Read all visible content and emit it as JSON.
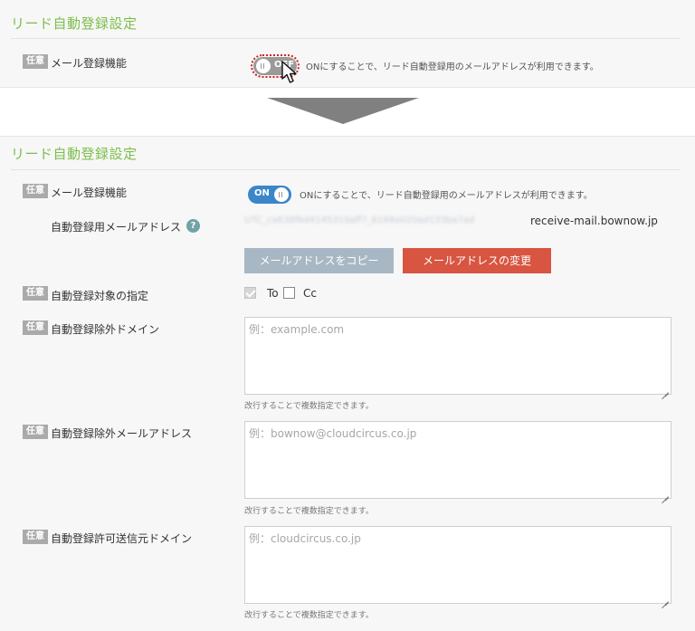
{
  "top": {
    "title": "リード自動登録設定",
    "optional_badge": "任意",
    "mail_registration_label": "メール登録機能",
    "toggle_state": "OFF",
    "toggle_text": "ON",
    "hint": "ONにすることで、リード自動登録用のメールアドレスが利用できます。"
  },
  "bottom": {
    "title": "リード自動登録設定",
    "mail_registration": {
      "badge": "任意",
      "label": "メール登録機能",
      "toggle_text": "ON",
      "hint": "ONにすることで、リード自動登録用のメールアドレスが利用できます。"
    },
    "address": {
      "label": "自動登録用メールアドレス",
      "help_icon": "?",
      "masked_local": "UTC_ca638f6d4145310aff7_6168a020ad133ba7ad",
      "domain": "receive-mail.bownow.jp"
    },
    "buttons": {
      "copy_label": "メールアドレスをコピー",
      "change_label": "メールアドレスの変更"
    },
    "target": {
      "badge": "任意",
      "label": "自動登録対象の指定",
      "to_label": "To",
      "cc_label": "Cc",
      "to_checked": true,
      "cc_checked": false
    },
    "exclude_domain": {
      "badge": "任意",
      "label": "自動登録除外ドメイン",
      "placeholder": "例：example.com",
      "help": "改行することで複数指定できます。"
    },
    "exclude_address": {
      "badge": "任意",
      "label": "自動登録除外メールアドレス",
      "placeholder": "例：bownow@cloudcircus.co.jp",
      "help": "改行することで複数指定できます。"
    },
    "allow_domain": {
      "badge": "任意",
      "label": "自動登録許可送信元ドメイン",
      "placeholder": "例：cloudcircus.co.jp",
      "help": "改行することで複数指定できます。"
    }
  },
  "icons": {
    "arrow": "down-arrow-icon",
    "cursor": "mouse-pointer-icon",
    "help": "question-circle-icon",
    "grip": "resize-handle-icon"
  },
  "colors": {
    "title_green": "#7dbd4b",
    "toggle_on": "#3a86c8",
    "toggle_off": "#9a9a9a",
    "copy_button": "#a7b7c3",
    "change_button": "#d85541",
    "badge": "#aaaaaa",
    "highlight_ring": "#d32121"
  }
}
